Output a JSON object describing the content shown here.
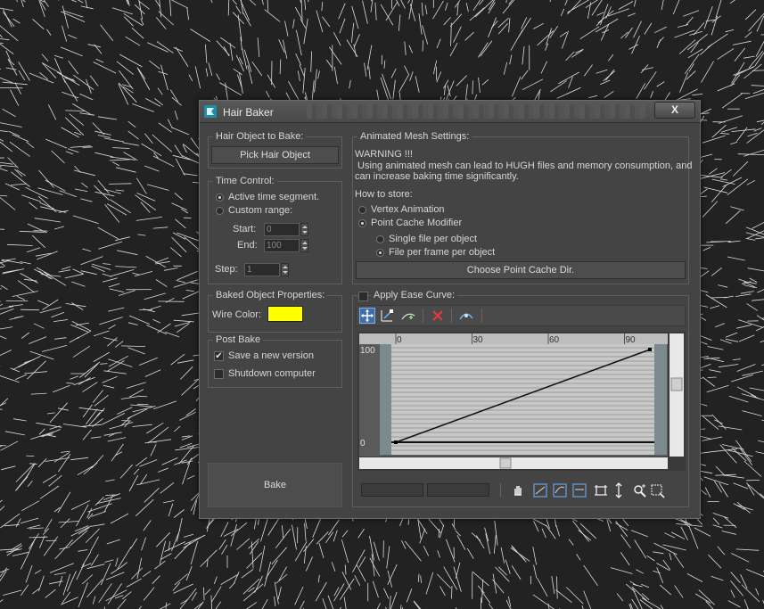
{
  "dialog": {
    "title": "Hair Baker",
    "close_label": "X"
  },
  "hair_object": {
    "group_title": "Hair Object to Bake:",
    "pick_button": "Pick Hair Object"
  },
  "time_control": {
    "group_title": "Time Control:",
    "options": [
      "Active time segment.",
      "Custom range:"
    ],
    "selected": "Active time segment.",
    "start_label": "Start:",
    "start_value": "0",
    "end_label": "End:",
    "end_value": "100",
    "step_label": "Step:",
    "step_value": "1"
  },
  "baked_props": {
    "group_title": "Baked Object Properties:",
    "wire_color_label": "Wire Color:",
    "wire_color": "#ffff00"
  },
  "post_bake": {
    "group_title": "Post Bake",
    "save_new_version": {
      "label": "Save a new version",
      "checked": true
    },
    "shutdown": {
      "label": "Shutdown computer",
      "checked": false
    }
  },
  "bake_button": "Bake",
  "animated_mesh": {
    "group_title": "Animated Mesh Settings:",
    "warning_title": "WARNING !!!",
    "warning_line1": " Using animated mesh can lead to HUGH files and memory consumption, and",
    "warning_line2": "can increase baking time significantly.",
    "how_to_store": "How to store:",
    "vertex_animation": "Vertex Animation",
    "point_cache_modifier": "Point Cache Modifier",
    "store_selected": "Point Cache Modifier",
    "single_file": "Single file per object",
    "file_per_frame": "File per frame per object",
    "file_selected": "File per frame per object",
    "choose_dir_button": "Choose Point Cache Dir."
  },
  "ease_curve": {
    "group_title": "Apply Ease Curve:",
    "enabled": false,
    "toolbar_icons": [
      "move-keys-icon",
      "scale-keys-icon",
      "insert-point-icon",
      "delete-point-icon",
      "reset-curve-icon"
    ],
    "bottom_icons": [
      "pan-icon",
      "zoom-extents-icon",
      "zoom-horizontal-extents-icon",
      "zoom-value-extents-icon",
      "zoom-horizontal-icon",
      "zoom-vertical-icon",
      "zoom-icon",
      "zoom-region-icon"
    ],
    "x_ticks": [
      "0",
      "30",
      "60",
      "90"
    ],
    "y_ticks": [
      "100",
      "0"
    ],
    "curve_start": [
      0,
      0
    ],
    "curve_end": [
      100,
      100
    ]
  }
}
